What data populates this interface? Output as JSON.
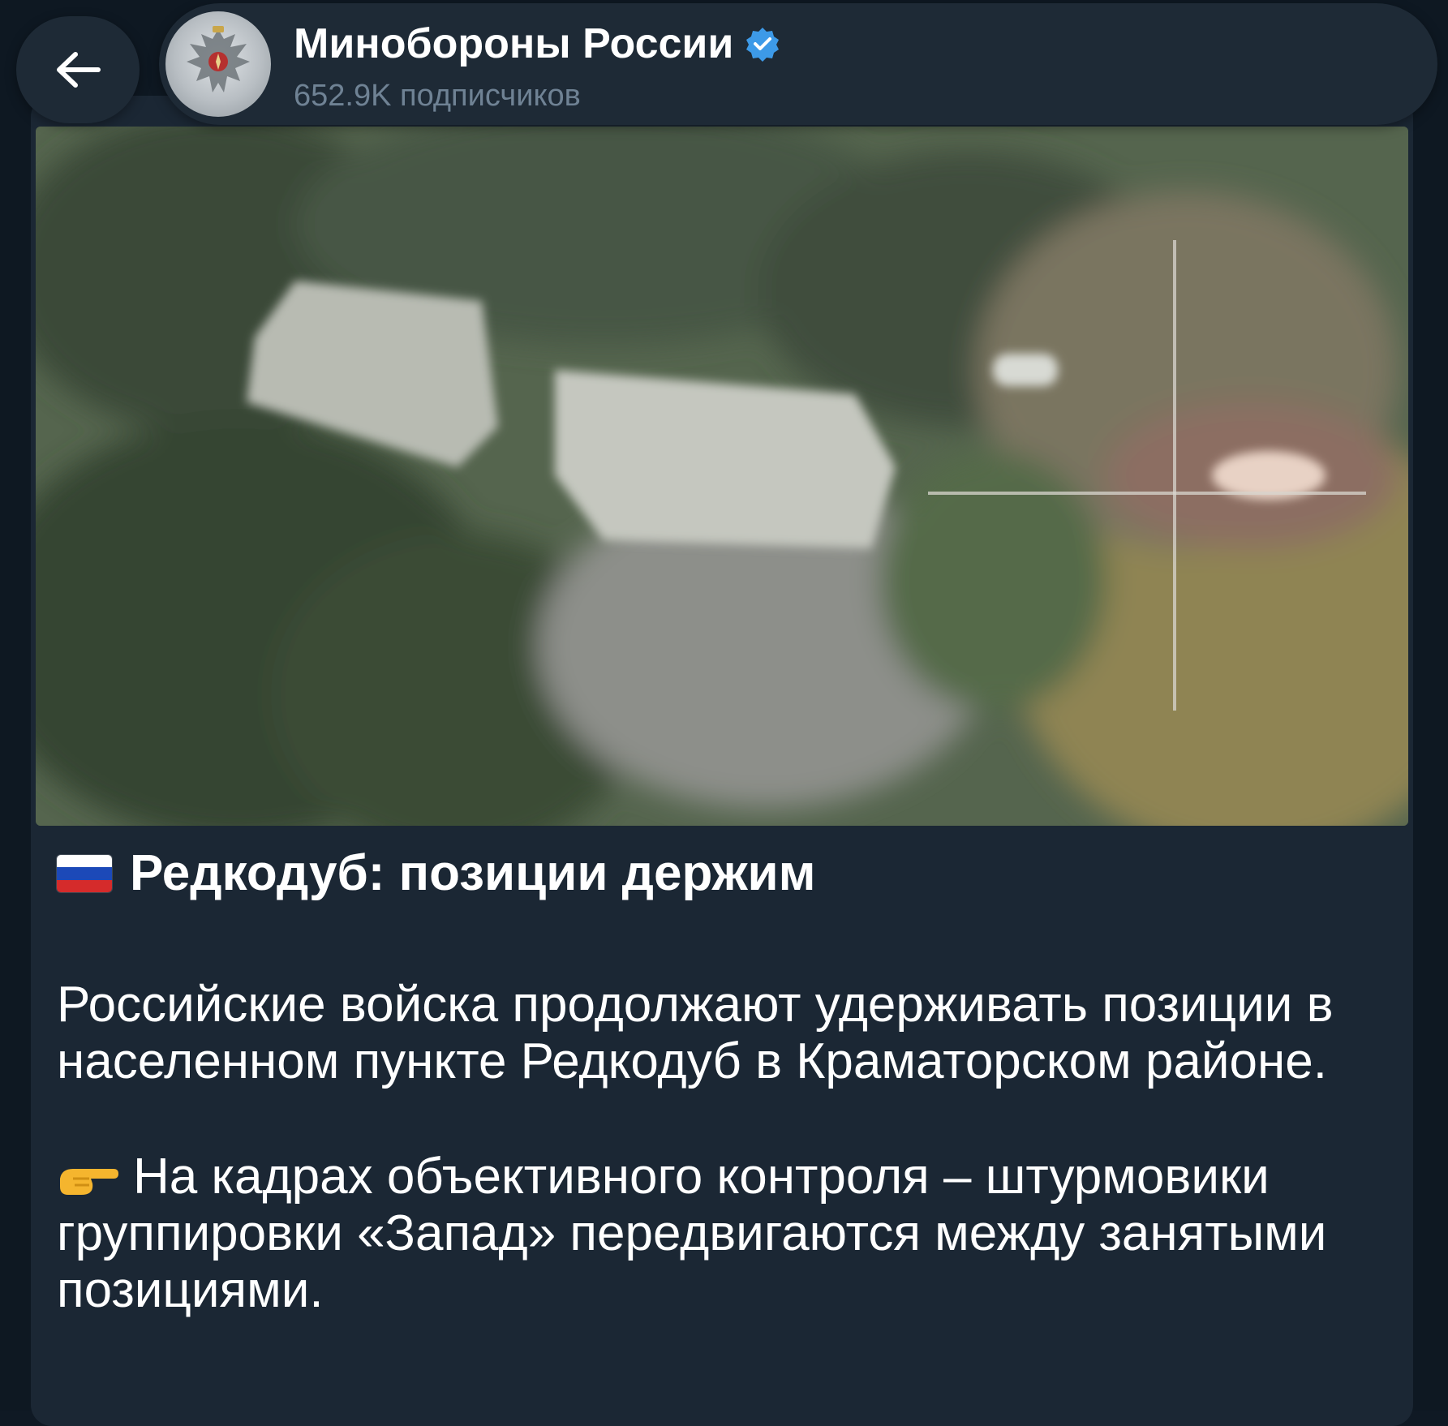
{
  "header": {
    "channel_name": "Минобороны России",
    "subscribers": "652.9K подписчиков",
    "verified": true
  },
  "post": {
    "flag": "russia-flag",
    "title": "Редкодуб: позиции держим",
    "paragraph1": "Российские войска продолжают удерживать позиции в населенном пункте Редкодуб в Краматорском районе.",
    "paragraph2_icon": "pointing-hand",
    "paragraph2": "На кадрах объективного контроля – штурмовики группировки «Запад» передвигаются между занятыми позициями."
  },
  "colors": {
    "accent": "#3d9ae8",
    "bubble": "#1b2734",
    "header": "#1e2a36"
  }
}
